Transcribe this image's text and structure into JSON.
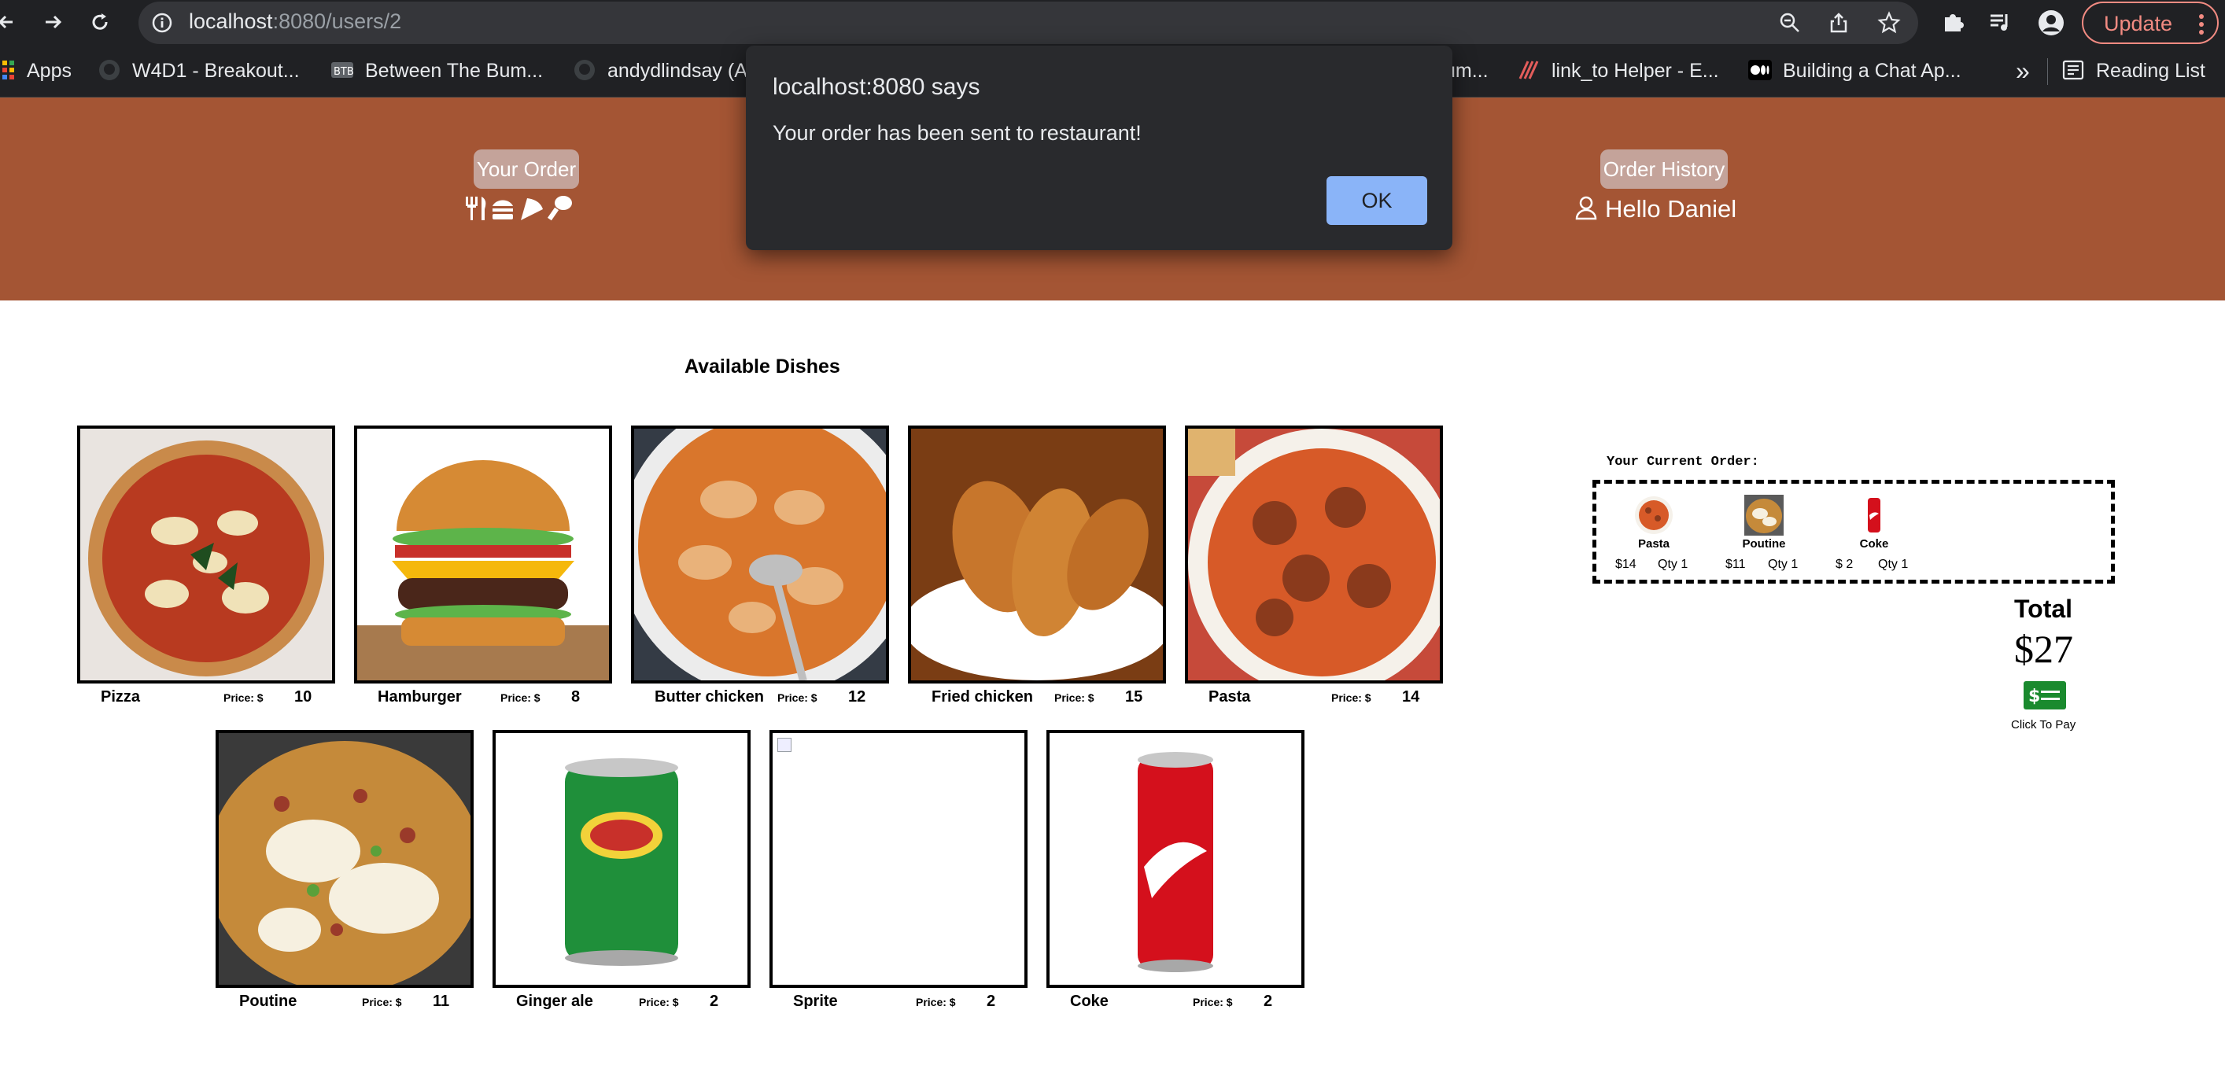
{
  "browser": {
    "url_host": "localhost",
    "url_rest": ":8080/users/2",
    "update_label": "Update",
    "bookmarks": [
      {
        "label": "Apps",
        "icon": "apps-grid-icon"
      },
      {
        "label": "W4D1 - Breakout...",
        "icon": "github-icon"
      },
      {
        "label": "Between The Bum...",
        "icon": "btb-icon"
      },
      {
        "label": "andydlindsay (A",
        "icon": "github-icon"
      },
      {
        "label": "um...",
        "icon": "page-icon"
      },
      {
        "label": "link_to Helper - E...",
        "icon": "rails-icon"
      },
      {
        "label": "Building a Chat Ap...",
        "icon": "medium-icon"
      }
    ],
    "more_label": "»",
    "reading_list": "Reading List"
  },
  "header": {
    "your_order": "Your Order",
    "greeting": "Hello Daniel",
    "order_history": "Order History"
  },
  "menu": {
    "title": "Available Dishes",
    "price_label": "Price: $",
    "dishes": [
      {
        "name": "Pizza",
        "price": "10"
      },
      {
        "name": "Hamburger",
        "price": "8"
      },
      {
        "name": "Butter chicken",
        "price": "12"
      },
      {
        "name": "Fried chicken",
        "price": "15"
      },
      {
        "name": "Pasta",
        "price": "14"
      },
      {
        "name": "Poutine",
        "price": "11"
      },
      {
        "name": "Ginger ale",
        "price": "2"
      },
      {
        "name": "Sprite",
        "price": "2"
      },
      {
        "name": "Coke",
        "price": "2"
      }
    ]
  },
  "order": {
    "title": "Your Current Order:",
    "items": [
      {
        "name": "Pasta",
        "price": "$14",
        "qty": "Qty 1"
      },
      {
        "name": "Poutine",
        "price": "$11",
        "qty": "Qty 1"
      },
      {
        "name": "Coke",
        "price": "$ 2",
        "qty": "Qty 1"
      }
    ],
    "total_label": "Total",
    "total_value": "$27",
    "pay_label": "Click To Pay"
  },
  "dialog": {
    "title": "localhost:8080 says",
    "message": "Your order has been sent to restaurant!",
    "ok_label": "OK"
  },
  "colors": {
    "header_bg": "#a45534",
    "header_button_bg": "#c4a39a",
    "pay_green": "#1a8a2e",
    "dialog_ok": "#8ab4f8"
  }
}
